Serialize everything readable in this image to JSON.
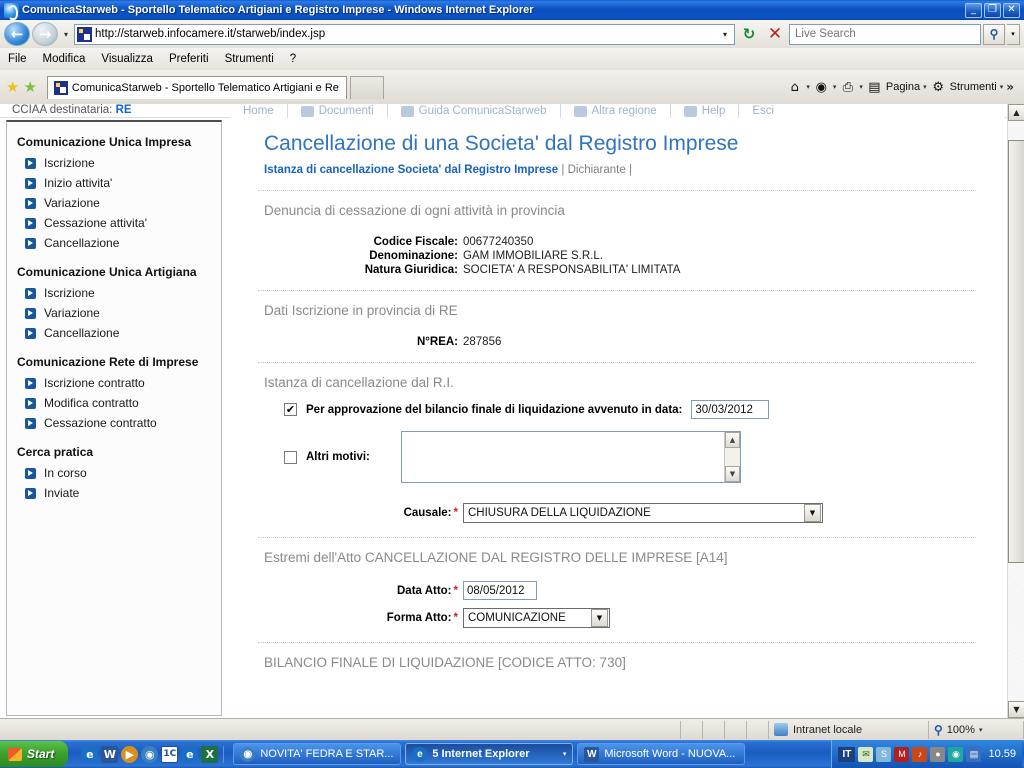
{
  "window": {
    "title": "ComunicaStarweb - Sportello Telematico Artigiani e Registro Imprese - Windows Internet Explorer",
    "minimize": "_",
    "maximize": "❐",
    "close": "✕"
  },
  "address_bar": {
    "back_icon": "←",
    "forward_icon": "→",
    "history_caret": "▾",
    "url": "http://starweb.infocamere.it/starweb/index.jsp",
    "url_dropdown_caret": "▾",
    "refresh_icon": "↻",
    "stop_icon": "✕",
    "search_placeholder": "Live Search",
    "search_value": "",
    "search_go_icon": "⚲",
    "search_dropdown_caret": "▾"
  },
  "menu": {
    "items": [
      "File",
      "Modifica",
      "Visualizza",
      "Preferiti",
      "Strumenti",
      "?"
    ]
  },
  "tabbar": {
    "favorites_star": "★",
    "add_favorites_star": "★",
    "tab_label": "ComunicaStarweb - Sportello Telematico Artigiani e Re...",
    "right_items": [
      {
        "name": "home",
        "icon": "⌂",
        "label": "",
        "caret": "▾"
      },
      {
        "name": "feeds",
        "icon": "◉",
        "label": "",
        "caret": "▾"
      },
      {
        "name": "print",
        "icon": "⎙",
        "label": "",
        "caret": "▾"
      },
      {
        "name": "page",
        "icon": "▤",
        "label": "Pagina",
        "caret": "▾"
      },
      {
        "name": "tools",
        "icon": "⚙",
        "label": "Strumenti",
        "caret": "▾"
      }
    ],
    "overflow": "»"
  },
  "page": {
    "cciaa_prefix": "CCIAA destinataria:",
    "cciaa_value": "RE",
    "topnav": [
      {
        "label": "Home"
      },
      {
        "label": "Documenti"
      },
      {
        "label": "Guida ComunicaStarweb"
      },
      {
        "label": "Altra regione"
      },
      {
        "label": "Help"
      },
      {
        "label": "Esci"
      }
    ],
    "title": "Cancellazione di una Societa' dal Registro Imprese",
    "breadcrumb_link": "Istanza di cancellazione Societa' dal Registro Imprese",
    "breadcrumb_sep1": "|",
    "breadcrumb_item2": "Dichiarante",
    "breadcrumb_sep2": "|"
  },
  "sidebar": {
    "groups": [
      {
        "title": "Comunicazione Unica Impresa",
        "items": [
          "Iscrizione",
          "Inizio attivita'",
          "Variazione",
          "Cessazione attivita'",
          "Cancellazione"
        ]
      },
      {
        "title": "Comunicazione Unica Artigiana",
        "items": [
          "Iscrizione",
          "Variazione",
          "Cancellazione"
        ]
      },
      {
        "title": "Comunicazione Rete di Imprese",
        "items": [
          "Iscrizione contratto",
          "Modifica contratto",
          "Cessazione contratto"
        ]
      },
      {
        "title": "Cerca pratica",
        "items": [
          "In corso",
          "Inviate"
        ]
      }
    ]
  },
  "sections": {
    "denuncia": {
      "heading": "Denuncia di cessazione di ogni attività in provincia",
      "fields": [
        {
          "label": "Codice Fiscale:",
          "value": "00677240350"
        },
        {
          "label": "Denominazione:",
          "value": "GAM IMMOBILIARE S.R.L."
        },
        {
          "label": "Natura Giuridica:",
          "value": "SOCIETA' A RESPONSABILITA' LIMITATA"
        }
      ]
    },
    "dati_iscrizione": {
      "heading": "Dati Iscrizione in provincia di RE",
      "fields": [
        {
          "label": "N°REA:",
          "value": "287856"
        }
      ]
    },
    "istanza": {
      "heading": "Istanza di cancellazione dal R.I.",
      "checkbox_bilancio": {
        "checked": true,
        "check_glyph": "✔",
        "label": "Per approvazione del bilancio finale di liquidazione avvenuto in data:",
        "date_value": "30/03/2012"
      },
      "checkbox_altri": {
        "checked": false,
        "check_glyph": "",
        "label": "Altri motivi:",
        "textarea_value": "",
        "scroll_up": "▲",
        "scroll_down": "▼"
      },
      "causale": {
        "label": "Causale:",
        "required": "*",
        "value": "CHIUSURA DELLA LIQUIDAZIONE",
        "caret": "▼"
      }
    },
    "estremi": {
      "heading": "Estremi dell'Atto CANCELLAZIONE DAL REGISTRO DELLE IMPRESE [A14]",
      "data_atto": {
        "label": "Data Atto:",
        "required": "*",
        "value": "08/05/2012"
      },
      "forma_atto": {
        "label": "Forma Atto:",
        "required": "*",
        "value": "COMUNICAZIONE",
        "caret": "▼"
      }
    },
    "bilancio": {
      "heading": "BILANCIO FINALE DI LIQUIDAZIONE [CODICE ATTO: 730]"
    }
  },
  "page_scrollbar": {
    "up": "▲",
    "down": "▼"
  },
  "statusbar": {
    "zone_label": "Intranet locale",
    "zoom_icon": "⚲",
    "zoom_level": "100%",
    "zoom_caret": "▾"
  },
  "taskbar": {
    "start_label": "Start",
    "quicklaunch": [
      {
        "name": "internet-explorer",
        "glyph": "e",
        "color": "#1a6fc4"
      },
      {
        "name": "word",
        "glyph": "W",
        "color": "#2a5699"
      },
      {
        "name": "media-player",
        "glyph": "▶",
        "color": "#d88f1e"
      },
      {
        "name": "globe",
        "glyph": "◉",
        "color": "#3a7fbf"
      },
      {
        "name": "one-c",
        "glyph": "1C",
        "color": "#1b4f9c"
      },
      {
        "name": "ie-small",
        "glyph": "e",
        "color": "#1a6fc4"
      },
      {
        "name": "excel-x",
        "glyph": "X",
        "color": "#1d7044"
      }
    ],
    "tasks": [
      {
        "name": "novita-fedra",
        "label": "NOVITA' FEDRA E STAR...",
        "icon_glyph": "◉",
        "icon_color": "#3a7fbf",
        "active": false,
        "caret": ""
      },
      {
        "name": "internet-explorer-group",
        "label": "5 Internet Explorer",
        "icon_glyph": "e",
        "icon_color": "#1a6fc4",
        "active": true,
        "caret": "▾"
      },
      {
        "name": "microsoft-word",
        "label": "Microsoft Word - NUOVA...",
        "icon_glyph": "W",
        "icon_color": "#2a5699",
        "active": false,
        "caret": ""
      }
    ],
    "tray": {
      "language": "IT",
      "icons": [
        {
          "name": "mail",
          "glyph": "✉",
          "color": "#d8e8c0"
        },
        {
          "name": "clock-sync",
          "glyph": "S",
          "color": "#7fb8d8"
        },
        {
          "name": "shield",
          "glyph": "M",
          "color": "#b02020"
        },
        {
          "name": "volume",
          "glyph": "♪",
          "color": "#c84818"
        },
        {
          "name": "network",
          "glyph": "●",
          "color": "#888888"
        },
        {
          "name": "eye",
          "glyph": "◉",
          "color": "#1fa8a0"
        },
        {
          "name": "book",
          "glyph": "▤",
          "color": "#3a6fc0"
        }
      ],
      "time": "10.59"
    }
  }
}
